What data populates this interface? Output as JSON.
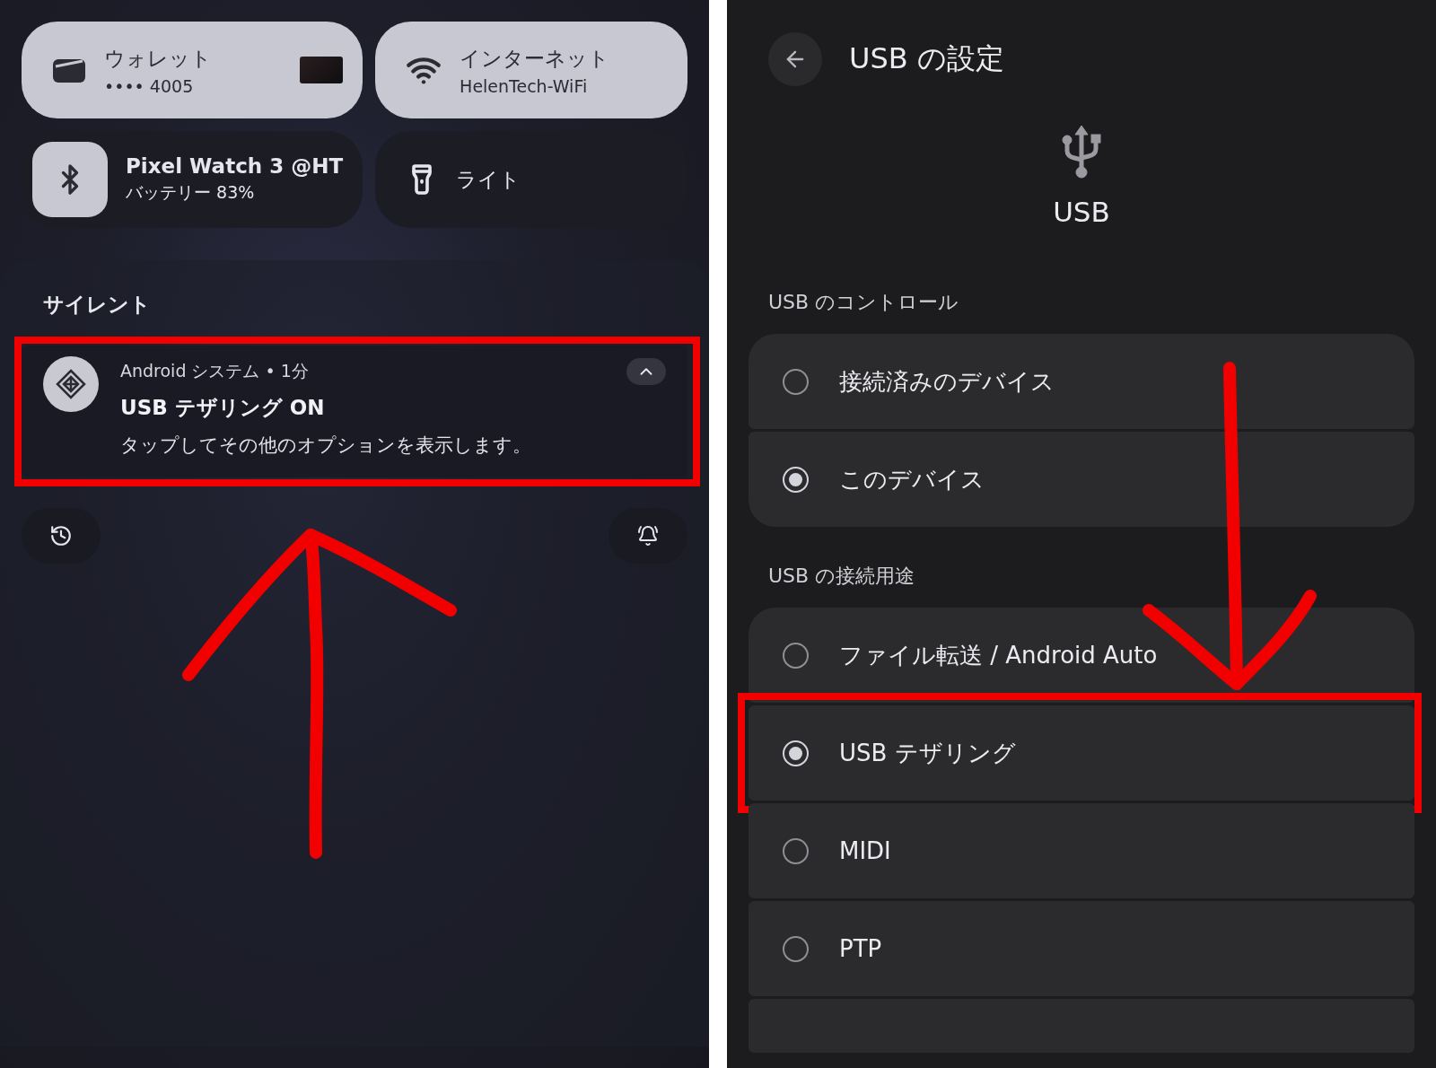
{
  "quick_settings": {
    "tiles": [
      {
        "kind": "wallet",
        "title": "ウォレット",
        "subtitle": "•••• 4005",
        "on": true
      },
      {
        "kind": "wifi",
        "title": "インターネット",
        "subtitle": "HelenTech-WiFi",
        "on": true
      },
      {
        "kind": "bluetooth",
        "title": "Pixel Watch 3 @HT",
        "subtitle": "バッテリー 83%",
        "on": true
      },
      {
        "kind": "flashlight",
        "title": "ライト",
        "on": false
      }
    ]
  },
  "notifications": {
    "section_title": "サイレント",
    "items": [
      {
        "meta": "Android システム • 1分",
        "title": "USB テザリング ON",
        "body": "タップしてその他のオプションを表示します。",
        "expanded": true,
        "highlighted": true
      }
    ]
  },
  "usb_settings": {
    "title": "USB の設定",
    "header_label": "USB",
    "sections": [
      {
        "label": "USB のコントロール",
        "options": [
          {
            "label": "接続済みのデバイス",
            "selected": false,
            "highlighted": false
          },
          {
            "label": "このデバイス",
            "selected": true,
            "highlighted": false
          }
        ]
      },
      {
        "label": "USB の接続用途",
        "options": [
          {
            "label": "ファイル転送 / Android Auto",
            "selected": false,
            "highlighted": false
          },
          {
            "label": "USB テザリング",
            "selected": true,
            "highlighted": true
          },
          {
            "label": "MIDI",
            "selected": false,
            "highlighted": false
          },
          {
            "label": "PTP",
            "selected": false,
            "highlighted": false
          }
        ]
      }
    ]
  }
}
